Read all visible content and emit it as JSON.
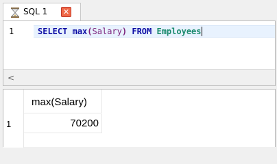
{
  "tab": {
    "label": "SQL 1",
    "close_glyph": "✕",
    "icon": "hourglass-icon"
  },
  "editor": {
    "line_number": "1",
    "code": {
      "select": "SELECT",
      "func": "max",
      "open_paren": "(",
      "column": "Salary",
      "close_paren": ")",
      "from": "FROM",
      "table": "Employees"
    },
    "scroll_left_glyph": "<"
  },
  "results": {
    "columns": [
      "max(Salary)"
    ],
    "rows": [
      {
        "row_number": "1",
        "values": [
          "70200"
        ]
      }
    ]
  },
  "colors": {
    "keyword": "#0d0da5",
    "identifier": "#7a1f7a",
    "table": "#1a8a6e",
    "close_button": "#f06a4a"
  }
}
